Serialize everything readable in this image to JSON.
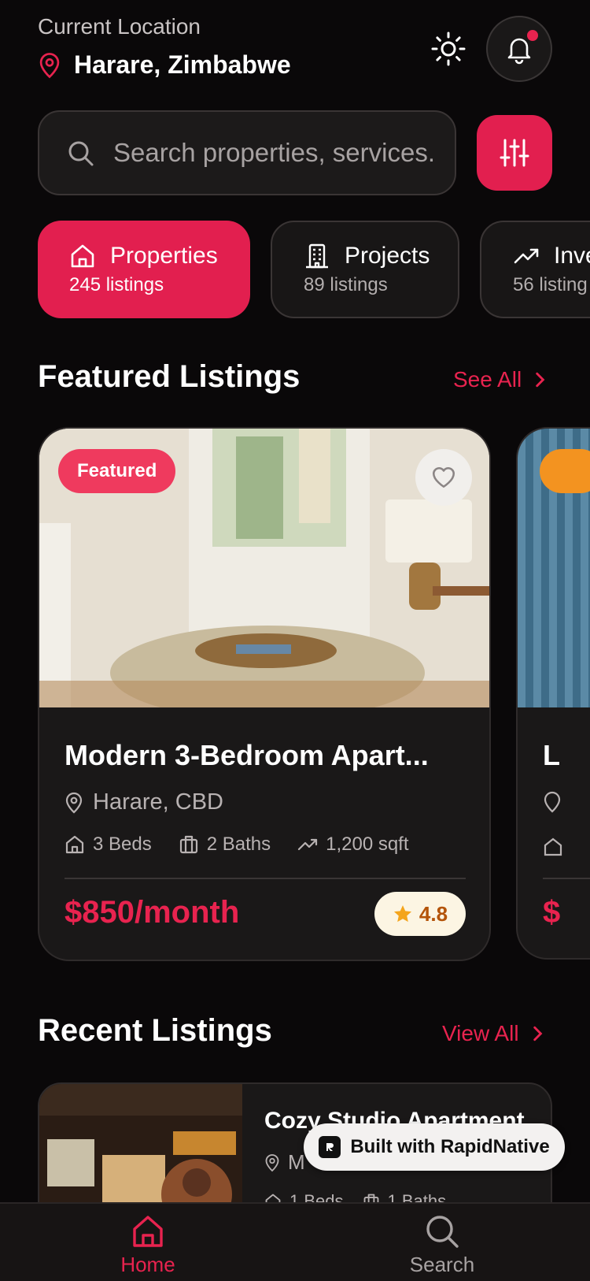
{
  "header": {
    "location_label": "Current Location",
    "city": "Harare, Zimbabwe",
    "icons": {
      "location": "map-pin-icon",
      "theme": "sun-icon",
      "notifications": "bell-icon"
    }
  },
  "search": {
    "placeholder": "Search properties, services...",
    "display": "Search properties, services."
  },
  "categories": [
    {
      "label": "Properties",
      "count": "245 listings",
      "icon": "home-icon",
      "active": true
    },
    {
      "label": "Projects",
      "count": "89 listings",
      "icon": "building-icon",
      "active": false
    },
    {
      "label": "Inve",
      "count": "56 listing",
      "icon": "trending-up-icon",
      "active": false
    }
  ],
  "featured": {
    "title": "Featured Listings",
    "see_all": "See All",
    "card": {
      "badge": "Featured",
      "title": "Modern 3-Bedroom Apart...",
      "location": "Harare, CBD",
      "beds": "3 Beds",
      "baths": "2 Baths",
      "area": "1,200 sqft",
      "price": "$850/month",
      "rating": "4.8"
    },
    "card2": {
      "title_partial": "L",
      "price_partial": "$"
    }
  },
  "recent": {
    "title": "Recent Listings",
    "view_all": "View All",
    "item": {
      "title": "Cozy Studio Apartment",
      "location_partial": "M",
      "beds": "1 Beds",
      "baths": "1 Baths"
    }
  },
  "badge_rapid": "Built with RapidNative",
  "nav": [
    {
      "label": "Home",
      "icon": "home-icon",
      "active": true
    },
    {
      "label": "Search",
      "icon": "search-icon",
      "active": false
    }
  ],
  "colors": {
    "accent": "#e21f4f",
    "background": "#0a0809",
    "card": "#1a1818",
    "rating_bg": "#fcf5e3",
    "star": "#f4a51c"
  }
}
